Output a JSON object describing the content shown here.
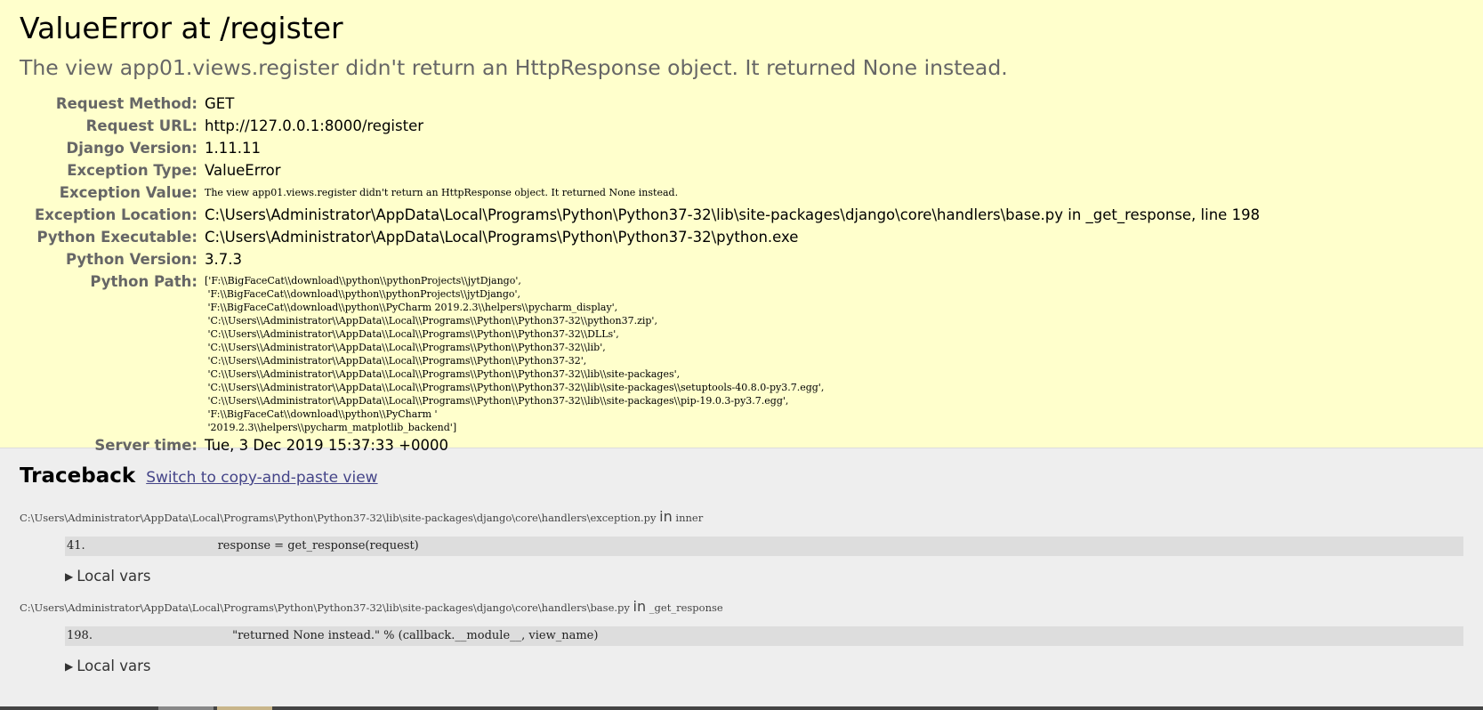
{
  "summary": {
    "title": "ValueError at /register",
    "subtitle": "The view app01.views.register didn't return an HttpResponse object. It returned None instead.",
    "meta": [
      {
        "label": "Request Method:",
        "value": "GET"
      },
      {
        "label": "Request URL:",
        "value": "http://127.0.0.1:8000/register"
      },
      {
        "label": "Django Version:",
        "value": "1.11.11"
      },
      {
        "label": "Exception Type:",
        "value": "ValueError"
      },
      {
        "label": "Exception Value:",
        "value": "The view app01.views.register didn't return an HttpResponse object. It returned None instead."
      },
      {
        "label": "Exception Location:",
        "value": "C:\\Users\\Administrator\\AppData\\Local\\Programs\\Python\\Python37-32\\lib\\site-packages\\django\\core\\handlers\\base.py in _get_response, line 198"
      },
      {
        "label": "Python Executable:",
        "value": "C:\\Users\\Administrator\\AppData\\Local\\Programs\\Python\\Python37-32\\python.exe"
      },
      {
        "label": "Python Version:",
        "value": "3.7.3"
      },
      {
        "label": "Python Path:",
        "value": "['F:\\\\BigFaceCat\\\\download\\\\python\\\\pythonProjects\\\\jytDjango',\n 'F:\\\\BigFaceCat\\\\download\\\\python\\\\pythonProjects\\\\jytDjango',\n 'F:\\\\BigFaceCat\\\\download\\\\python\\\\PyCharm 2019.2.3\\\\helpers\\\\pycharm_display',\n 'C:\\\\Users\\\\Administrator\\\\AppData\\\\Local\\\\Programs\\\\Python\\\\Python37-32\\\\python37.zip',\n 'C:\\\\Users\\\\Administrator\\\\AppData\\\\Local\\\\Programs\\\\Python\\\\Python37-32\\\\DLLs',\n 'C:\\\\Users\\\\Administrator\\\\AppData\\\\Local\\\\Programs\\\\Python\\\\Python37-32\\\\lib',\n 'C:\\\\Users\\\\Administrator\\\\AppData\\\\Local\\\\Programs\\\\Python\\\\Python37-32',\n 'C:\\\\Users\\\\Administrator\\\\AppData\\\\Local\\\\Programs\\\\Python\\\\Python37-32\\\\lib\\\\site-packages',\n 'C:\\\\Users\\\\Administrator\\\\AppData\\\\Local\\\\Programs\\\\Python\\\\Python37-32\\\\lib\\\\site-packages\\\\setuptools-40.8.0-py3.7.egg',\n 'C:\\\\Users\\\\Administrator\\\\AppData\\\\Local\\\\Programs\\\\Python\\\\Python37-32\\\\lib\\\\site-packages\\\\pip-19.0.3-py3.7.egg',\n 'F:\\\\BigFaceCat\\\\download\\\\python\\\\PyCharm '\n '2019.2.3\\\\helpers\\\\pycharm_matplotlib_backend']"
      },
      {
        "label": "Server time:",
        "value": "Tue, 3 Dec 2019 15:37:33 +0000"
      }
    ]
  },
  "traceback": {
    "heading": "Traceback",
    "switch_link": "Switch to copy-and-paste view",
    "in_word": "in",
    "local_vars_label": "Local vars",
    "frames": [
      {
        "file": "C:\\Users\\Administrator\\AppData\\Local\\Programs\\Python\\Python37-32\\lib\\site-packages\\django\\core\\handlers\\exception.py",
        "function": "inner",
        "line_number": "41.",
        "code": "            response = get_response(request)"
      },
      {
        "file": "C:\\Users\\Administrator\\AppData\\Local\\Programs\\Python\\Python37-32\\lib\\site-packages\\django\\core\\handlers\\base.py",
        "function": "_get_response",
        "line_number": "198.",
        "code": "                \"returned None instead.\" % (callback.__module__, view_name)"
      }
    ]
  }
}
